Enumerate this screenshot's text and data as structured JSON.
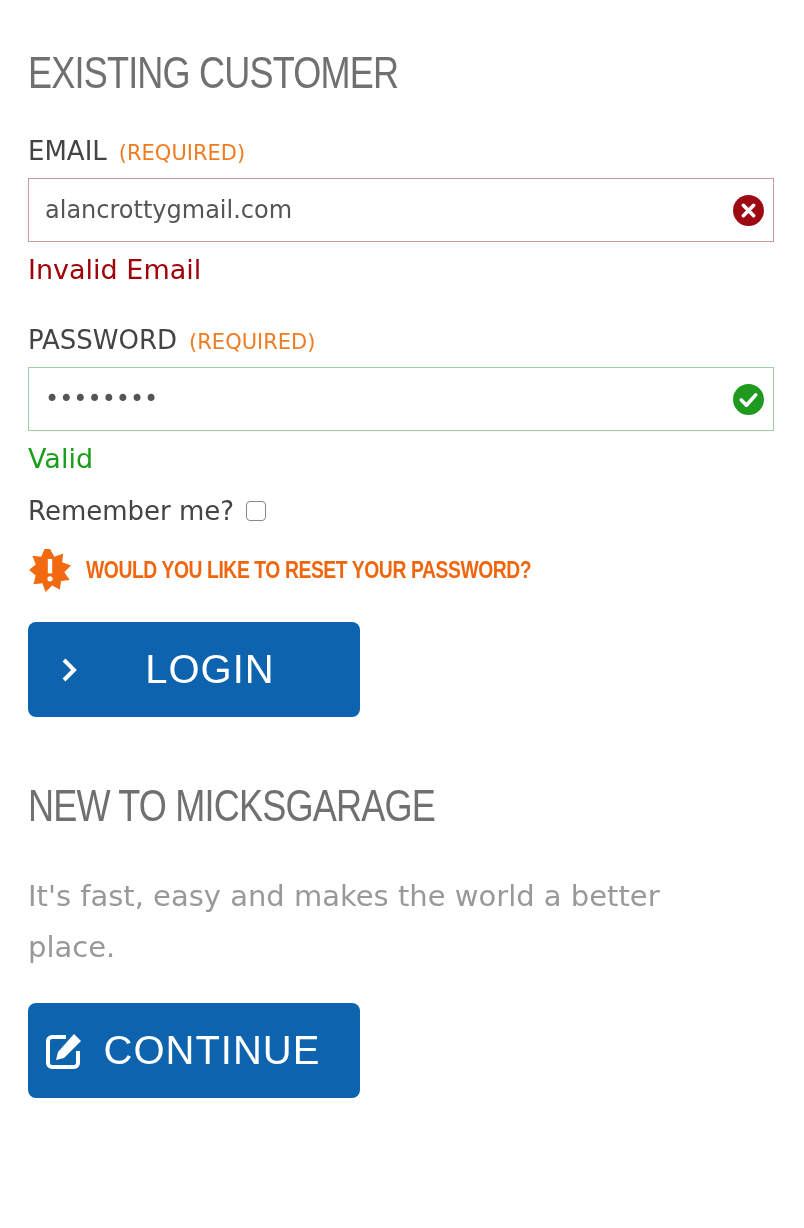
{
  "existing_customer": {
    "heading": "EXISTING CUSTOMER",
    "fields": [
      {
        "label": "EMAIL",
        "required": "(REQUIRED)",
        "value": "alancrottygmail.com",
        "valid": false,
        "message": "Invalid Email"
      },
      {
        "label": "PASSWORD",
        "required": "(REQUIRED)",
        "value": "••••••••",
        "valid": true,
        "message": "Valid"
      }
    ],
    "remember": {
      "label": "Remember me?",
      "checked": false
    },
    "reset_link": "WOULD YOU LIKE TO RESET YOUR PASSWORD?",
    "login_button": "LOGIN"
  },
  "new_customer": {
    "heading": "NEW TO MICKSGARAGE",
    "text": "It's fast, easy and makes the world a better place.",
    "continue_button": "CONTINUE"
  }
}
